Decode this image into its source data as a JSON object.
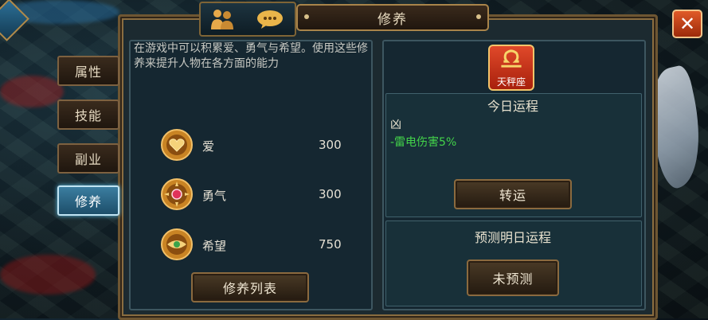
{
  "window": {
    "title": "修养"
  },
  "tabs": [
    {
      "label": "属性",
      "active": false
    },
    {
      "label": "技能",
      "active": false
    },
    {
      "label": "副业",
      "active": false
    },
    {
      "label": "修养",
      "active": true
    }
  ],
  "left_panel": {
    "description": "在游戏中可以积累爱、勇气与希望。使用这些修养来提升人物在各方面的能力",
    "stats": [
      {
        "name": "爱",
        "value": "300",
        "icon": "heart-medal-icon"
      },
      {
        "name": "勇气",
        "value": "300",
        "icon": "gem-medal-icon"
      },
      {
        "name": "希望",
        "value": "750",
        "icon": "eye-medal-icon"
      }
    ],
    "list_button": "修养列表"
  },
  "right_panel": {
    "zodiac": {
      "label": "天秤座",
      "icon": "libra-icon",
      "color": "#d63a1e"
    },
    "today": {
      "title": "今日运程",
      "level": "凶",
      "effect": "-雷电伤害5%",
      "button": "转运"
    },
    "predict": {
      "title": "预测明日运程",
      "button": "未预测"
    }
  },
  "colors": {
    "accent_gold": "#a9844a",
    "active_tab": "#3b7ea0",
    "effect_green": "#43d34a",
    "close_red": "#e05a28"
  }
}
